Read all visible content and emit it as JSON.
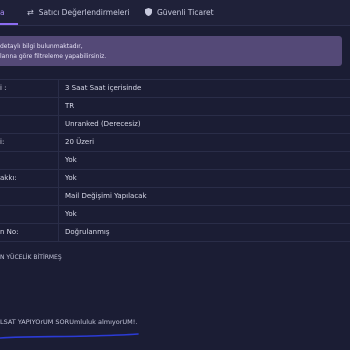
{
  "tabs": [
    {
      "label": "a",
      "icon": "",
      "active": true
    },
    {
      "label": "Satıcı Değerlendirmeleri",
      "icon": "swap-arrows-icon",
      "active": false
    },
    {
      "label": "Güvenli Ticaret",
      "icon": "shield-icon",
      "active": false
    }
  ],
  "banner": {
    "line1": "detaylı bilgi bulunmaktadır,",
    "line2": "larına göre filtreleme yapabilirsiniz."
  },
  "table": {
    "rows": [
      {
        "label": "i :",
        "value": "3 Saat Saat içerisinde"
      },
      {
        "label": "",
        "value": "TR"
      },
      {
        "label": "",
        "value": "Unranked (Derecesiz)"
      },
      {
        "label": "i:",
        "value": "20 Üzeri"
      },
      {
        "label": "",
        "value": "Yok"
      },
      {
        "label": "akkı:",
        "value": "Yok"
      },
      {
        "label": "",
        "value": "Mail Değişimi Yapılacak"
      },
      {
        "label": "",
        "value": "Yok"
      },
      {
        "label": "n No:",
        "value": "Doğrulanmış"
      }
    ]
  },
  "note": "N YÜCELİK BİTİRMEŞ",
  "bottom_text": "LSAT YAPIYOrUM SORUmluluk almıyorUM!.",
  "colors": {
    "background": "#1b1d34",
    "accent": "#8c6cf2",
    "banner": "#544977",
    "annotation_line": "#2b3bd6"
  }
}
